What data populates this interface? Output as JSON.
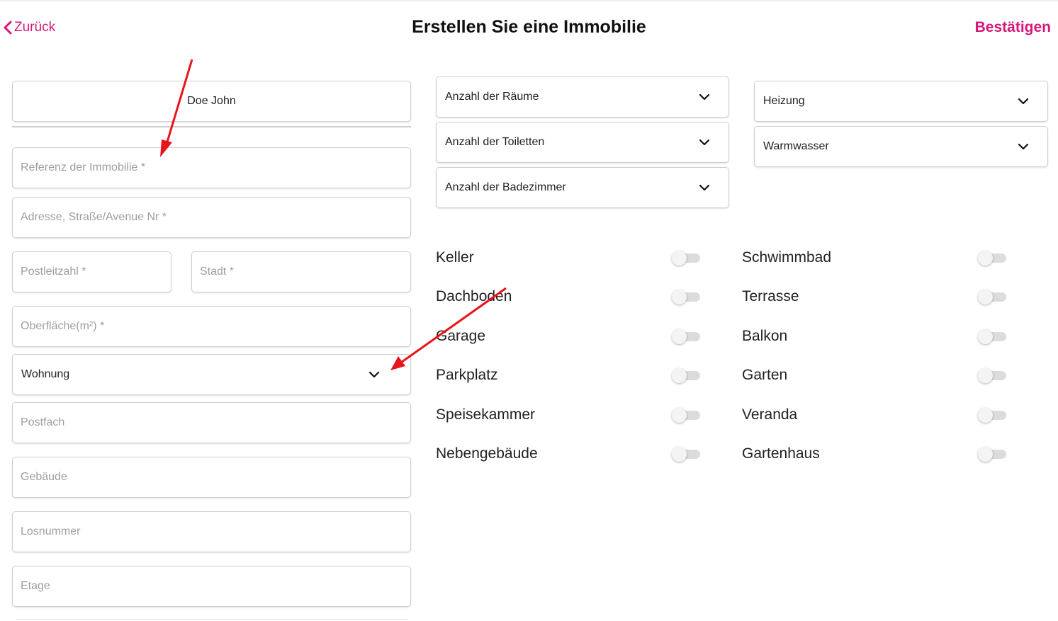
{
  "header": {
    "back_label": "Zurück",
    "title": "Erstellen Sie eine Immobilie",
    "confirm_label": "Bestätigen"
  },
  "form": {
    "owner_value": "Doe John",
    "reference_placeholder": "Referenz der Immobilie *",
    "address_placeholder": "Adresse, Straße/Avenue Nr *",
    "postal_code_placeholder": "Postleitzahl *",
    "city_placeholder": "Stadt *",
    "surface_placeholder": "Oberfläche(m²) *",
    "property_type_value": "Wohnung",
    "po_box_placeholder": "Postfach",
    "building_placeholder": "Gebäude",
    "lot_number_placeholder": "Losnummer",
    "floor_placeholder": "Etage"
  },
  "selects": {
    "rooms": "Anzahl der Räume",
    "toilets": "Anzahl der Toiletten",
    "bathrooms": "Anzahl der Badezimmer",
    "heating": "Heizung",
    "hot_water": "Warmwasser"
  },
  "toggles_left": [
    {
      "label": "Keller",
      "on": false
    },
    {
      "label": "Dachboden",
      "on": false
    },
    {
      "label": "Garage",
      "on": false
    },
    {
      "label": "Parkplatz",
      "on": false
    },
    {
      "label": "Speisekammer",
      "on": false
    },
    {
      "label": "Nebengebäude",
      "on": false
    }
  ],
  "toggles_right": [
    {
      "label": "Schwimmbad",
      "on": false
    },
    {
      "label": "Terrasse",
      "on": false
    },
    {
      "label": "Balkon",
      "on": false
    },
    {
      "label": "Garten",
      "on": false
    },
    {
      "label": "Veranda",
      "on": false
    },
    {
      "label": "Gartenhaus",
      "on": false
    }
  ],
  "colors": {
    "accent": "#d5197a",
    "annotation_arrow": "#e8131b"
  }
}
